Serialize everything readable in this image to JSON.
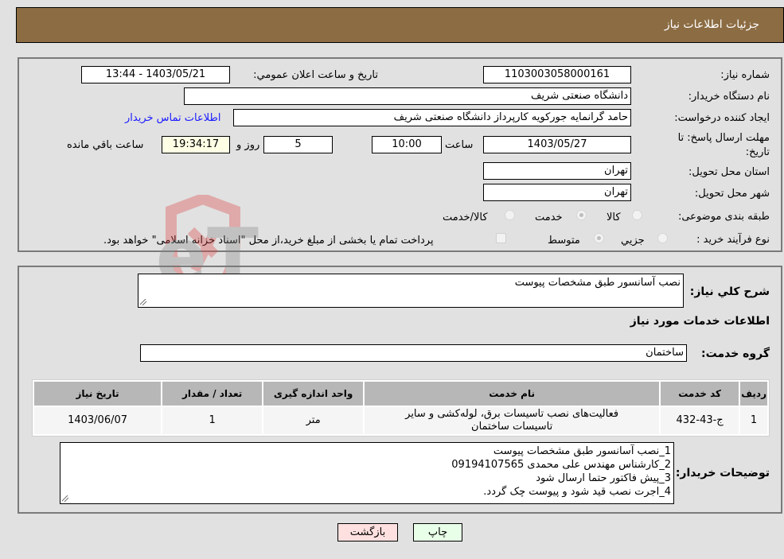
{
  "header": {
    "title": "جزئیات اطلاعات نیاز"
  },
  "form": {
    "need_number": {
      "label": "شماره نیاز:",
      "value": "1103003058000161"
    },
    "announce_datetime": {
      "label": "تاریخ و ساعت اعلان عمومي:",
      "value": "1403/05/21 - 13:44"
    },
    "buyer_org": {
      "label": "نام دستگاه خریدار:",
      "value": "دانشگاه صنعتی شریف"
    },
    "requester": {
      "label": "ایجاد کننده درخواست:",
      "value": "حامد گرانمایه جورکویه کارپرداز دانشگاه صنعتی شریف",
      "contact_link": "اطلاعات تماس خریدار"
    },
    "deadline": {
      "label": "مهلت ارسال پاسخ: تا تاریخ:",
      "date": "1403/05/27",
      "time_label": "ساعت",
      "time": "10:00",
      "days": "5",
      "days_label": "روز و",
      "remaining": "19:34:17",
      "remaining_label": "ساعت باقي مانده"
    },
    "province": {
      "label": "استان محل تحویل:",
      "value": "تهران"
    },
    "city": {
      "label": "شهر محل تحویل:",
      "value": "تهران"
    },
    "category": {
      "label": "طبقه بندی موضوعی:",
      "options": [
        {
          "label": "کالا",
          "checked": false
        },
        {
          "label": "خدمت",
          "checked": true
        },
        {
          "label": "کالا/خدمت",
          "checked": false
        }
      ]
    },
    "purchase_type": {
      "label": "نوع فرآیند خرید :",
      "options": [
        {
          "label": "جزيي",
          "checked": false
        },
        {
          "label": "متوسط",
          "checked": true
        }
      ],
      "treasury_note": "پرداخت تمام یا بخشی از مبلغ خرید،از محل \"اسناد خزانه اسلامی\" خواهد بود."
    }
  },
  "details": {
    "summary_label": "شرح کلي نیاز:",
    "summary_value": "نصب آسانسور طبق مشخصات پیوست",
    "services_heading": "اطلاعات خدمات مورد نیاز",
    "service_group_label": "گروه خدمت:",
    "service_group_value": "ساختمان",
    "table": {
      "headers": [
        "ردیف",
        "کد خدمت",
        "نام خدمت",
        "واحد اندازه گیری",
        "تعداد / مقدار",
        "تاریخ نیاز"
      ],
      "rows": [
        [
          "1",
          "ج-43-432",
          "فعالیت‌های نصب تاسیسات برق، لوله‌کشی و سایر تاسیسات ساختمان",
          "متر",
          "1",
          "1403/06/07"
        ]
      ]
    },
    "buyer_notes_label": "توضیحات خریدار:",
    "buyer_notes": [
      "1_نصب آسانسور طبق مشخصات پیوست",
      "2_کارشناس مهندس علی محمدی 09194107565",
      "3_پیش فاکتور حتما ارسال شود",
      "4_اجرت نصب قید شود و پیوست چک گردد."
    ]
  },
  "buttons": {
    "print": "چاپ",
    "back": "بازگشت"
  },
  "watermark": {
    "text": "AriaTender.neT"
  }
}
